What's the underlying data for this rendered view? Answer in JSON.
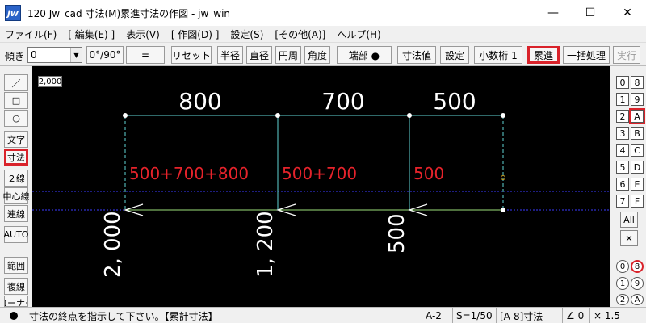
{
  "window": {
    "title": "120 Jw_cad 寸法(M)累進寸法の作図 - jw_win",
    "icon_text": "jw",
    "controls": {
      "minimize": "—",
      "maximize": "☐",
      "close": "✕"
    }
  },
  "menu": [
    "ファイル(F)",
    "[ 編集(E) ]",
    "表示(V)",
    "[ 作図(D) ]",
    "設定(S)",
    "[その他(A)]",
    "ヘルプ(H)"
  ],
  "toolbar": {
    "angle_label": "傾き",
    "angle_value": "0",
    "btn_0_90": "0°/90°",
    "btn_equal": "=",
    "btn_reset": "リセット",
    "btn_radius": "半径",
    "btn_diameter": "直径",
    "btn_circum": "円周",
    "btn_angle": "角度",
    "btn_endpoint": "端部 ●",
    "btn_dim_value": "寸法値",
    "btn_settings": "設定",
    "btn_decimal": "小数桁 1",
    "btn_cumulative": "累進",
    "btn_batch": "一括処理",
    "btn_execute": "実行"
  },
  "left_tools": [
    "／",
    "□",
    "○",
    "文字",
    "寸法",
    "２線",
    "中心線",
    "連線",
    "AUTO",
    "範囲",
    "複線",
    "コーナー"
  ],
  "canvas": {
    "scale_box": "2,000",
    "colors": {
      "background": "#000000",
      "white": "#ffffff",
      "cyan": "#5fd3d3",
      "red": "#e6232b",
      "green": "#9be07a",
      "blue": "#3a3aff"
    },
    "top_labels": [
      "800",
      "700",
      "500"
    ],
    "red_labels": [
      "500+700+800",
      "500+700",
      "500"
    ],
    "vertical_labels": [
      "2, 000",
      "1, 200",
      "500"
    ]
  },
  "layers": {
    "left": [
      "0",
      "1",
      "2",
      "3",
      "4",
      "5",
      "6",
      "7"
    ],
    "right": [
      "8",
      "9",
      "A",
      "B",
      "C",
      "D",
      "E",
      "F"
    ],
    "all_label": "All",
    "x_label": "✕",
    "groups_left": [
      "0",
      "1",
      "2"
    ],
    "groups_right": [
      "8",
      "9",
      "A"
    ]
  },
  "status": {
    "message": "寸法の終点を指示して下さい。【累計寸法】",
    "paper": "A-2",
    "scale": "S=1/50",
    "layer": "[A-8]寸法",
    "angle": "∠ 0",
    "zoom": "× 1.5"
  }
}
